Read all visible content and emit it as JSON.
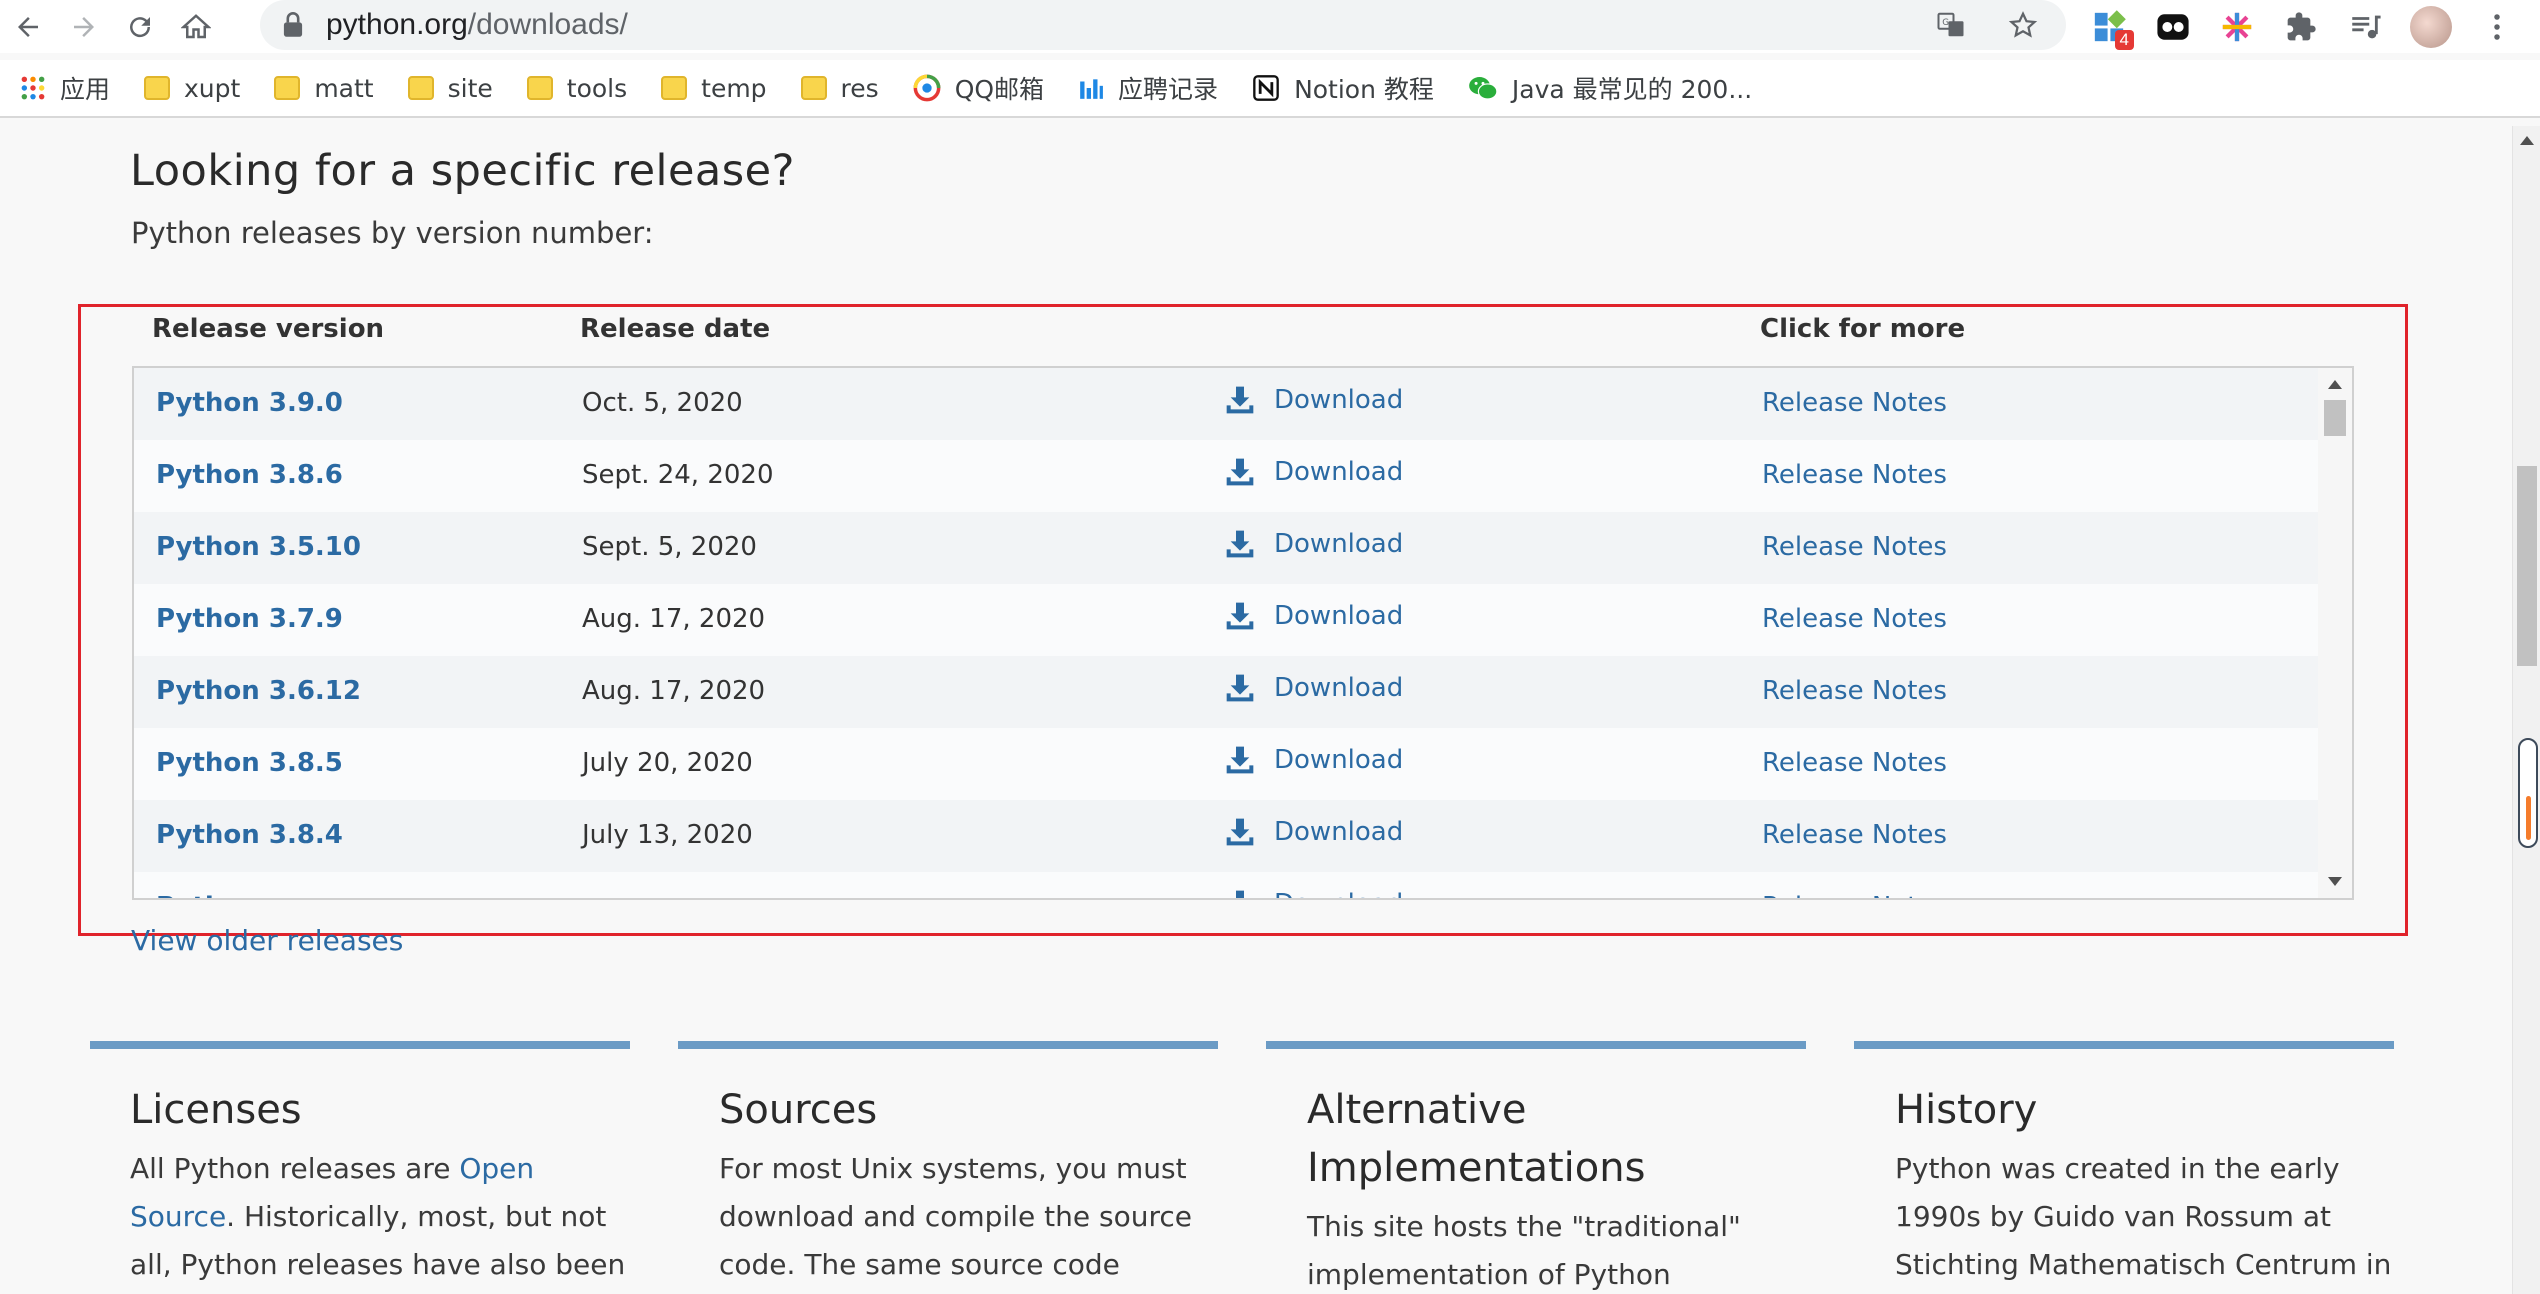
{
  "browser": {
    "url_host": "python.org",
    "url_path": "/downloads/",
    "extension_badge": "4",
    "bookmarks": [
      "应用",
      "xupt",
      "matt",
      "site",
      "tools",
      "temp",
      "res",
      "QQ邮箱",
      "应聘记录",
      "Notion 教程",
      "Java 最常见的 200..."
    ]
  },
  "page": {
    "title": "Looking for a specific release?",
    "subtitle": "Python releases by version number:",
    "headers": {
      "version": "Release version",
      "date": "Release date",
      "more": "Click for more"
    },
    "releases": [
      {
        "version": "Python 3.9.0",
        "date": "Oct. 5, 2020",
        "download": "Download",
        "notes": "Release Notes"
      },
      {
        "version": "Python 3.8.6",
        "date": "Sept. 24, 2020",
        "download": "Download",
        "notes": "Release Notes"
      },
      {
        "version": "Python 3.5.10",
        "date": "Sept. 5, 2020",
        "download": "Download",
        "notes": "Release Notes"
      },
      {
        "version": "Python 3.7.9",
        "date": "Aug. 17, 2020",
        "download": "Download",
        "notes": "Release Notes"
      },
      {
        "version": "Python 3.6.12",
        "date": "Aug. 17, 2020",
        "download": "Download",
        "notes": "Release Notes"
      },
      {
        "version": "Python 3.8.5",
        "date": "July 20, 2020",
        "download": "Download",
        "notes": "Release Notes"
      },
      {
        "version": "Python 3.8.4",
        "date": "July 13, 2020",
        "download": "Download",
        "notes": "Release Notes"
      },
      {
        "version": "Python ...",
        "date": "...",
        "download": "Download",
        "notes": "Release Notes"
      }
    ],
    "older_link": "View older releases",
    "columns": [
      {
        "title": "Licenses",
        "text_before": "All Python releases are ",
        "link": "Open Source",
        "text_after": ". Historically, most, but not all, Python releases have also been GPL-"
      },
      {
        "title": "Sources",
        "text_before": "For most Unix systems, you must download and compile the source code. The same source code archive",
        "link": "",
        "text_after": ""
      },
      {
        "title": "Alternative Implementations",
        "text_before": "This site hosts the \"traditional\" implementation of Python",
        "link": "",
        "text_after": ""
      },
      {
        "title": "History",
        "text_before": "Python was created in the early 1990s by Guido van Rossum at Stichting Mathematisch Centrum in",
        "link": "",
        "text_after": ""
      }
    ]
  },
  "colors": {
    "link": "#2b6aa3",
    "highlight": "#e0232b",
    "column_bar": "#6b9bc5"
  },
  "icons": [
    "back-icon",
    "forward-icon",
    "reload-icon",
    "home-icon",
    "lock-icon",
    "translate-icon",
    "star-icon",
    "extension-icon",
    "puzzle-icon",
    "media-icon",
    "menu-icon",
    "download-icon"
  ]
}
